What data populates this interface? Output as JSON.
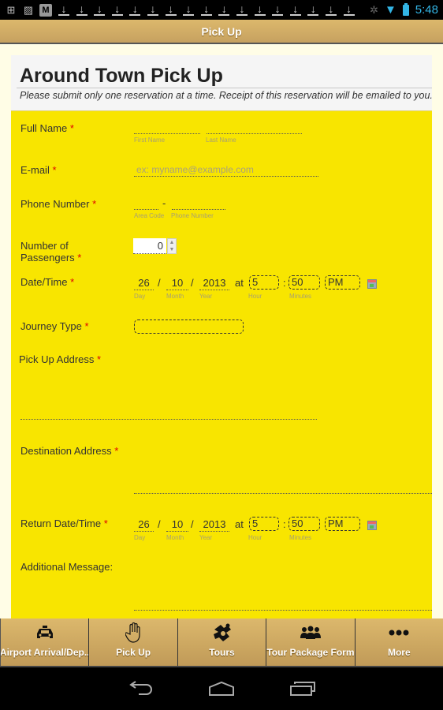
{
  "status_bar": {
    "notification_icons": [
      "add-icon",
      "image-icon",
      "gmail-icon"
    ],
    "download_count": 17,
    "time": "5:48"
  },
  "title_bar": {
    "title": "Pick Up"
  },
  "form": {
    "title": "Around Town Pick Up",
    "subtitle": "Please submit only one reservation at a time. Receipt of this reservation will be emailed to you.",
    "required_mark": "*",
    "full_name": {
      "label": "Full Name",
      "first_sub": "First Name",
      "last_sub": "Last Name",
      "first_value": "",
      "last_value": ""
    },
    "email": {
      "label": "E-mail",
      "placeholder": "ex: myname@example.com",
      "value": ""
    },
    "phone": {
      "label": "Phone Number",
      "separator": "-",
      "area_sub": "Area Code",
      "number_sub": "Phone Number"
    },
    "passengers": {
      "label_line1": "Number of",
      "label_line2": "Passengers",
      "value": "0"
    },
    "datetime": {
      "label": "Date/Time",
      "day": "26",
      "month": "10",
      "year": "2013",
      "at": "at",
      "hour": "5",
      "minutes": "50",
      "ampm": "PM",
      "day_sub": "Day",
      "month_sub": "Month",
      "year_sub": "Year",
      "hour_sub": "Hour",
      "minutes_sub": "Minutes",
      "slash": "/",
      "colon": ":"
    },
    "journey_type": {
      "label": "Journey Type",
      "value": ""
    },
    "pickup_address": {
      "label": "Pick Up Address"
    },
    "destination_address": {
      "label": "Destination Address"
    },
    "return_datetime": {
      "label": "Return Date/Time",
      "day": "26",
      "month": "10",
      "year": "2013",
      "at": "at",
      "hour": "5",
      "minutes": "50",
      "ampm": "PM",
      "day_sub": "Day",
      "month_sub": "Month",
      "year_sub": "Year",
      "hour_sub": "Hour",
      "minutes_sub": "Minutes",
      "slash": "/",
      "colon": ":"
    },
    "additional_message": {
      "label": "Additional Message:"
    }
  },
  "tabs": [
    {
      "label": "Airport Arrival/Dep..",
      "icon": "taxi-icon"
    },
    {
      "label": "Pick Up",
      "icon": "hand-icon"
    },
    {
      "label": "Tours",
      "icon": "tours-icon"
    },
    {
      "label": "Tour Package Form",
      "icon": "group-icon"
    },
    {
      "label": "More",
      "icon": "more-icon"
    }
  ],
  "colors": {
    "form_bg": "#f8e500",
    "page_bg": "#fffde6",
    "tab_bg": "#d4b068",
    "required": "#e00000",
    "clock": "#33b5e5"
  }
}
